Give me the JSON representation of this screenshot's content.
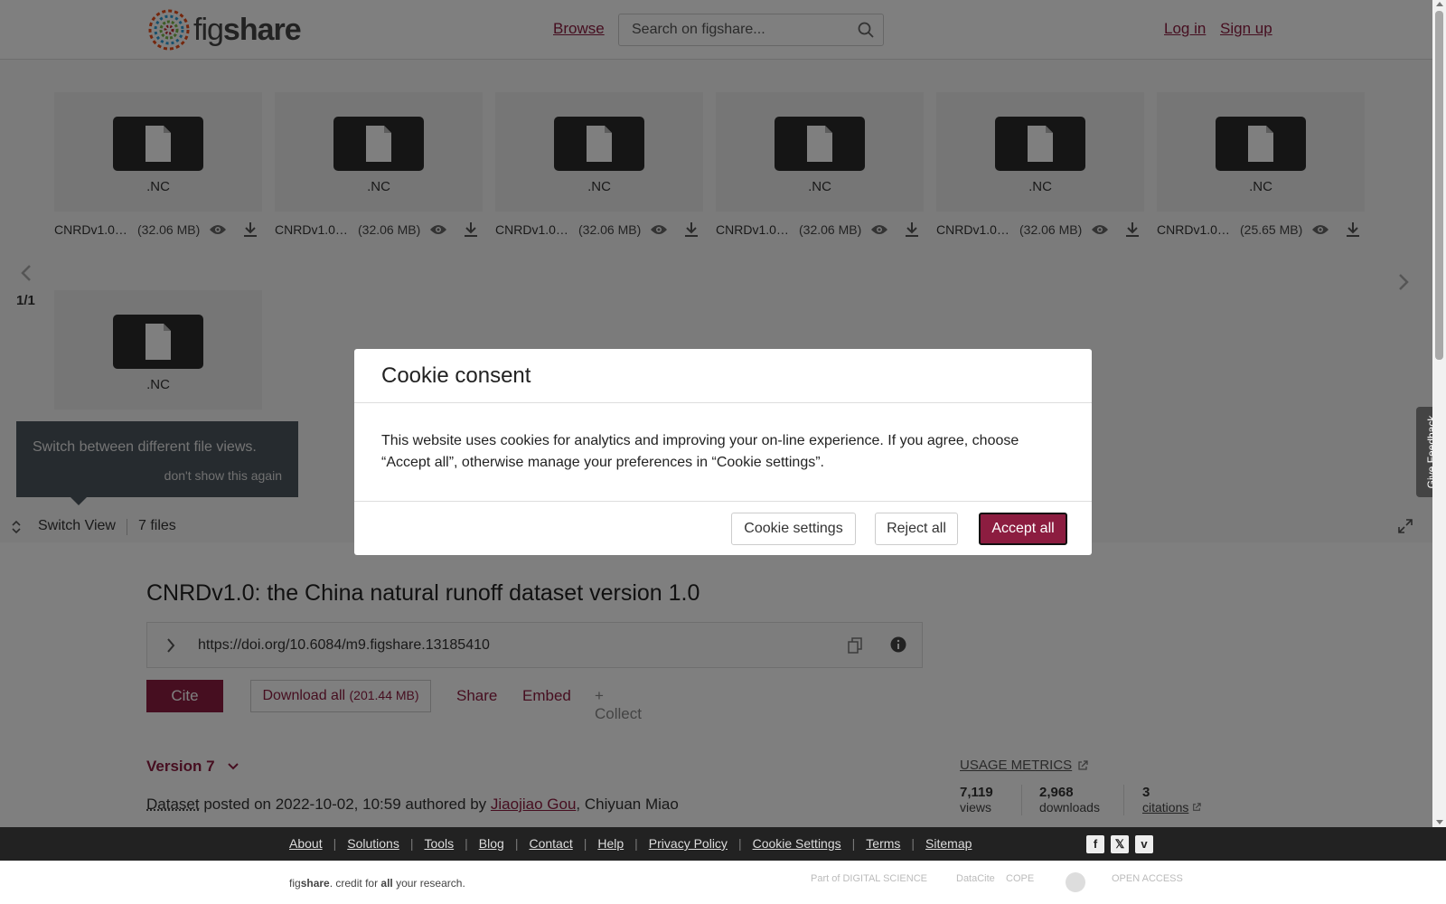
{
  "header": {
    "logo_prefix": "fig",
    "logo_suffix": "share",
    "browse": "Browse",
    "search_placeholder": "Search on figshare...",
    "login": "Log in",
    "signup": "Sign up"
  },
  "viewer": {
    "files": [
      {
        "ext": ".NC",
        "name": "CNRDv1.0…",
        "size": "(32.06 MB)"
      },
      {
        "ext": ".NC",
        "name": "CNRDv1.0…",
        "size": "(32.06 MB)"
      },
      {
        "ext": ".NC",
        "name": "CNRDv1.0…",
        "size": "(32.06 MB)"
      },
      {
        "ext": ".NC",
        "name": "CNRDv1.0…",
        "size": "(32.06 MB)"
      },
      {
        "ext": ".NC",
        "name": "CNRDv1.0…",
        "size": "(32.06 MB)"
      },
      {
        "ext": ".NC",
        "name": "CNRDv1.0…",
        "size": "(25.65 MB)"
      },
      {
        "ext": ".NC"
      }
    ],
    "pager": "1/1",
    "tooltip_text": "Switch between different file views.",
    "tooltip_dismiss": "don't show this again",
    "switch_view": "Switch View",
    "files_count": "7 files"
  },
  "article": {
    "title": "CNRDv1.0: the China natural runoff dataset version 1.0",
    "doi": "https://doi.org/10.6084/m9.figshare.13185410",
    "cite": "Cite",
    "download_all": "Download all",
    "download_size": "(201.44 MB)",
    "share": "Share",
    "embed": "Embed",
    "collect": "+ Collect",
    "version": "Version 7",
    "posted_type": "Dataset",
    "posted_text": " posted on 2022-10-02, 10:59 authored by ",
    "author1": "Jiaojiao Gou",
    "author_sep": ", ",
    "author2": "Chiyuan Miao"
  },
  "metrics": {
    "usage_label": "USAGE METRICS",
    "views_num": "7,119",
    "views_label": "views",
    "downloads_num": "2,968",
    "downloads_label": "downloads",
    "citations_num": "3",
    "citations_label": "citations"
  },
  "cookie": {
    "title": "Cookie consent",
    "body": "This website uses cookies for analytics and improving your on-line experience. If you agree, choose “Accept all”, otherwise manage your preferences in “Cookie settings”.",
    "settings": "Cookie settings",
    "reject": "Reject all",
    "accept": "Accept all"
  },
  "feedback": "Give Feedback",
  "footer": {
    "links": [
      "About",
      "Solutions",
      "Tools",
      "Blog",
      "Contact",
      "Help",
      "Privacy Policy",
      "Cookie Settings",
      "Terms",
      "Sitemap"
    ],
    "social": [
      "facebook-icon",
      "x-icon",
      "vimeo-icon"
    ],
    "tagline_prefix": "fig",
    "tagline_brand": "share",
    "tagline_mid": ". credit for ",
    "tagline_all": "all",
    "tagline_end": " your research.",
    "partner_digital": "Part of DIGITAL SCIENCE",
    "partner_datacite": "DataCite",
    "partner_cope": "COPE",
    "partner_open": "OPEN ACCESS"
  },
  "colors": {
    "brand": "#8c1d40",
    "footer_bg": "#222222",
    "tile_bg": "#ececec"
  }
}
